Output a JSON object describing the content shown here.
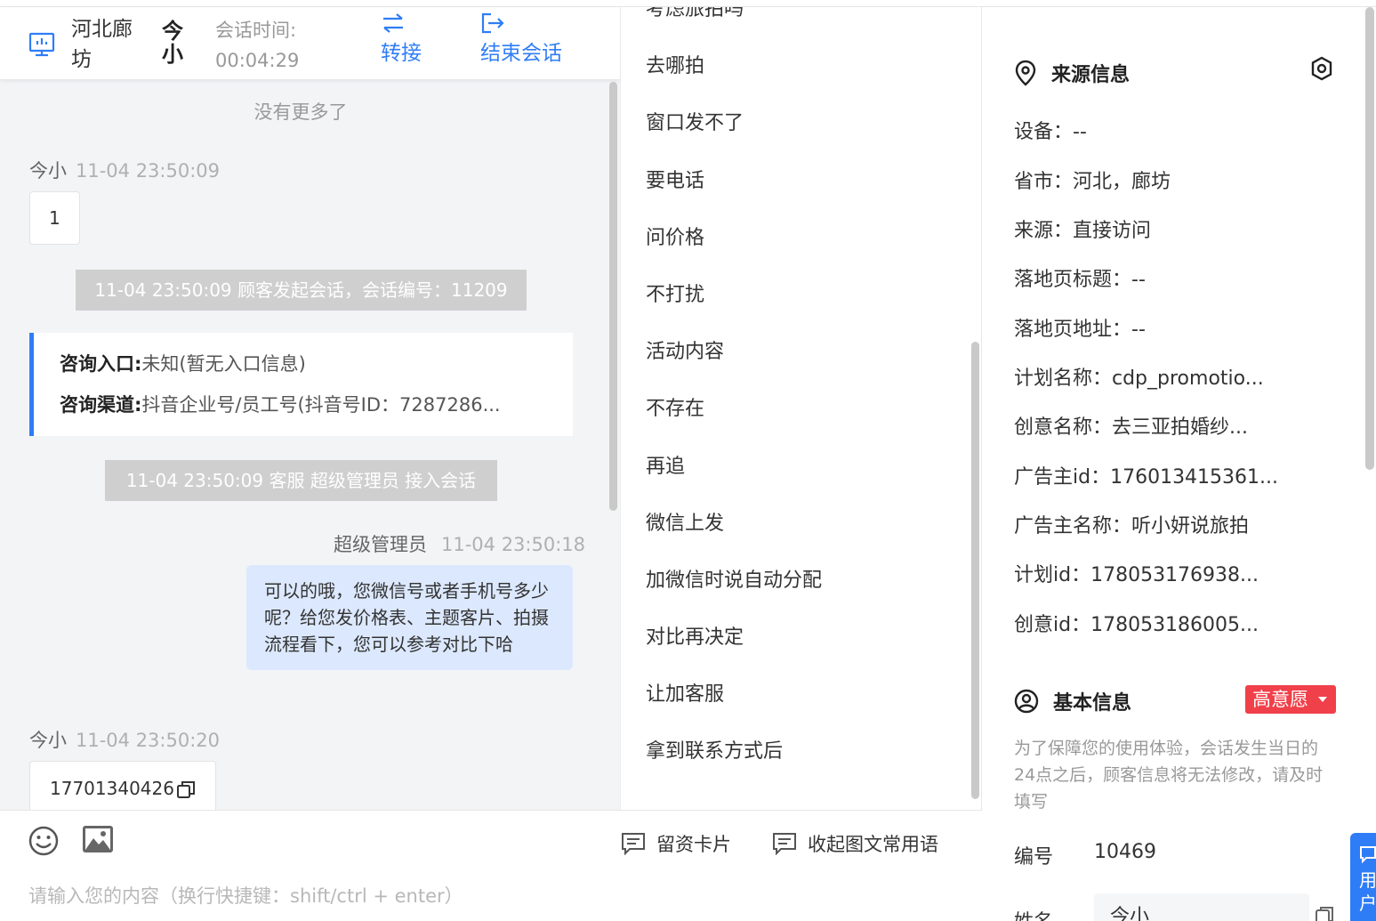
{
  "header": {
    "location": "河北廊坊",
    "customer_name": "今小",
    "session_time_label": "会话时间:",
    "session_time_value": "00:04:29",
    "transfer_label": "转接",
    "end_label": "结束会话"
  },
  "chat": {
    "no_more": "没有更多了",
    "msg1": {
      "sender": "今小",
      "time": "11-04 23:50:09",
      "text": "1"
    },
    "sys1": "11-04 23:50:09 顾客发起会话，会话编号：11209",
    "info_card": {
      "entry_label": "咨询入口:",
      "entry_value": "未知(暂无入口信息)",
      "channel_label": "咨询渠道:",
      "channel_value": "抖音企业号/员工号(抖音号ID：7287286..."
    },
    "sys2": "11-04 23:50:09 客服 超级管理员 接入会话",
    "msg2": {
      "sender": "超级管理员",
      "time": "11-04 23:50:18",
      "text": "可以的哦，您微信号或者手机号多少呢？给您发价格表、主题客片、拍摄流程看下，您可以参考对比下哈"
    },
    "msg3": {
      "sender": "今小",
      "time": "11-04 23:50:20",
      "text": "17701340426"
    }
  },
  "input": {
    "placeholder": "请输入您的内容（换行快捷键：shift/ctrl + enter）",
    "card_label": "留资卡片",
    "collapse_label": "收起图文常用语"
  },
  "phrases": {
    "items": [
      "考虑旅拍吗",
      "去哪拍",
      "窗口发不了",
      "要电话",
      "问价格",
      "不打扰",
      "活动内容",
      "不存在",
      "再追",
      "微信上发",
      "加微信时说自动分配",
      "对比再决定",
      "让加客服",
      "拿到联系方式后"
    ]
  },
  "source_info": {
    "title": "来源信息",
    "rows": [
      "设备：--",
      "省市：河北，廊坊",
      "来源：直接访问",
      "落地页标题：--",
      "落地页地址：--",
      "计划名称：cdp_promotio...",
      "创意名称：去三亚拍婚纱...",
      "广告主id：176013415361...",
      "广告主名称：听小妍说旅拍",
      "计划id：178053176938...",
      "创意id：178053186005..."
    ]
  },
  "basic_info": {
    "title": "基本信息",
    "badge": "高意愿",
    "notice": "为了保障您的使用体验，会话发生当日的24点之后，顾客信息将无法修改，请及时填写",
    "id_label": "编号",
    "id_value": "10469",
    "name_label": "姓名",
    "name_value": "今小",
    "float_tab": "用户"
  },
  "colors": {
    "accent": "#2f7df6",
    "badge": "#f0404a",
    "self_bubble": "#dce8fd"
  }
}
